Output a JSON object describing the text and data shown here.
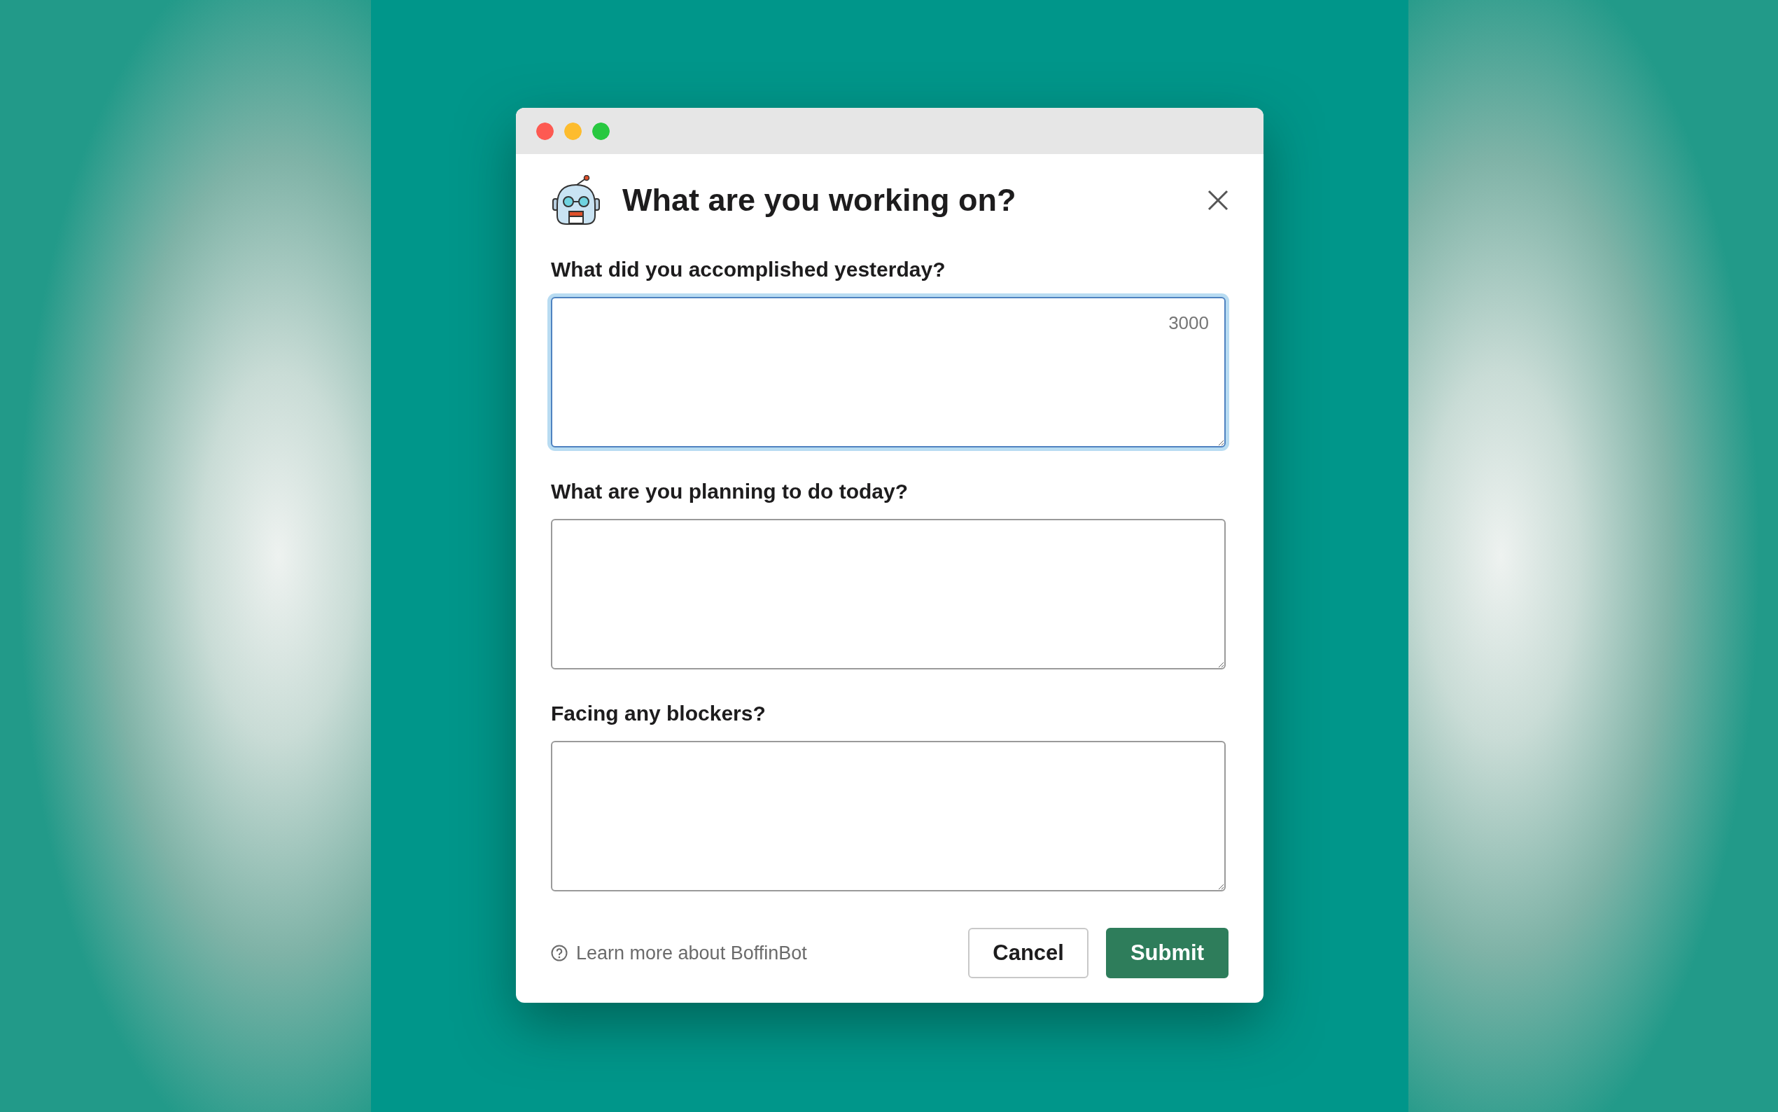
{
  "dialog": {
    "title": "What are you working on?",
    "fields": [
      {
        "label": "What did you accomplished yesterday?",
        "counter": "3000",
        "focused": true
      },
      {
        "label": "What are you planning to do today?",
        "focused": false
      },
      {
        "label": "Facing any blockers?",
        "focused": false
      }
    ],
    "help_link": "Learn more about BoffinBot",
    "buttons": [
      {
        "label": "Cancel",
        "kind": "secondary"
      },
      {
        "label": "Submit",
        "kind": "primary"
      }
    ]
  }
}
